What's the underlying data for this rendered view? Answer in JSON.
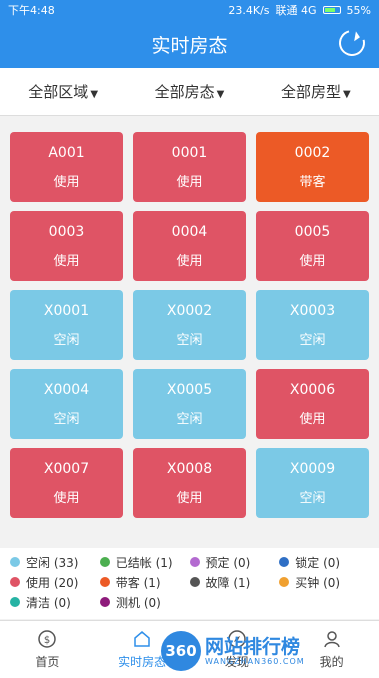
{
  "status": {
    "time": "下午4:48",
    "network_speed": "23.4K/s",
    "carrier": "联通 4G",
    "battery": "55%"
  },
  "header": {
    "title": "实时房态",
    "refresh_icon": "refresh-icon"
  },
  "filters": [
    {
      "label": "全部区域"
    },
    {
      "label": "全部房态"
    },
    {
      "label": "全部房型"
    }
  ],
  "rooms": [
    {
      "code": "A001",
      "status": "使用"
    },
    {
      "code": "0001",
      "status": "使用"
    },
    {
      "code": "0002",
      "status": "带客"
    },
    {
      "code": "0003",
      "status": "使用"
    },
    {
      "code": "0004",
      "status": "使用"
    },
    {
      "code": "0005",
      "status": "使用"
    },
    {
      "code": "X0001",
      "status": "空闲"
    },
    {
      "code": "X0002",
      "status": "空闲"
    },
    {
      "code": "X0003",
      "status": "空闲"
    },
    {
      "code": "X0004",
      "status": "空闲"
    },
    {
      "code": "X0005",
      "status": "空闲"
    },
    {
      "code": "X0006",
      "status": "使用"
    },
    {
      "code": "X0007",
      "status": "使用"
    },
    {
      "code": "X0008",
      "status": "使用"
    },
    {
      "code": "X0009",
      "status": "空闲"
    },
    {
      "code": "",
      "status": ""
    },
    {
      "code": "",
      "status": ""
    },
    {
      "code": "",
      "status": ""
    }
  ],
  "legend": [
    {
      "label": "空闲 (33)",
      "color": "#7bc9e6"
    },
    {
      "label": "已结帐 (1)",
      "color": "#4caf50"
    },
    {
      "label": "预定 (0)",
      "color": "#b36ad0"
    },
    {
      "label": "锁定 (0)",
      "color": "#2f6fc5"
    },
    {
      "label": "使用 (20)",
      "color": "#df5465"
    },
    {
      "label": "带客 (1)",
      "color": "#ec5a26"
    },
    {
      "label": "故障 (1)",
      "color": "#555555"
    },
    {
      "label": "买钟 (0)",
      "color": "#f0a030"
    },
    {
      "label": "清洁 (0)",
      "color": "#26b3a4"
    },
    {
      "label": "测机 (0)",
      "color": "#8e1b7b"
    }
  ],
  "tabs": [
    {
      "label": "首页",
      "icon": "home-icon"
    },
    {
      "label": "实时房态",
      "icon": "house-icon"
    },
    {
      "label": "发现",
      "icon": "discover-icon"
    },
    {
      "label": "我的",
      "icon": "user-icon"
    }
  ],
  "watermark": {
    "logo": "360",
    "text": "网站排行榜",
    "sub": "WANGZHAN360.COM"
  }
}
